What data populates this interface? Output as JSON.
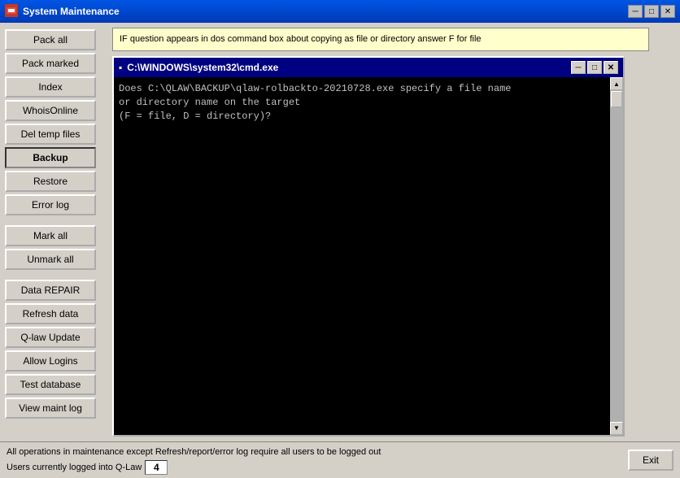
{
  "window": {
    "title": "System Maintenance",
    "title_icon": "⚙"
  },
  "titlebar_controls": {
    "minimize": "─",
    "maximize": "□",
    "close": "✕"
  },
  "sidebar": {
    "buttons": [
      {
        "id": "pack-all",
        "label": "Pack all",
        "active": false
      },
      {
        "id": "pack-marked",
        "label": "Pack marked",
        "active": false
      },
      {
        "id": "index",
        "label": "Index",
        "active": false
      },
      {
        "id": "whois-online",
        "label": "WhoisOnline",
        "active": false
      },
      {
        "id": "del-temp-files",
        "label": "Del temp files",
        "active": false
      },
      {
        "id": "backup",
        "label": "Backup",
        "active": true
      },
      {
        "id": "restore",
        "label": "Restore",
        "active": false
      },
      {
        "id": "error-log",
        "label": "Error log",
        "active": false
      },
      {
        "id": "mark-all",
        "label": "Mark all",
        "active": false
      },
      {
        "id": "unmark-all",
        "label": "Unmark all",
        "active": false
      },
      {
        "id": "data-repair",
        "label": "Data REPAIR",
        "active": false
      },
      {
        "id": "refresh-data",
        "label": "Refresh data",
        "active": false
      },
      {
        "id": "q-law-update",
        "label": "Q-law Update",
        "active": false
      },
      {
        "id": "allow-logins",
        "label": "Allow Logins",
        "active": false
      },
      {
        "id": "test-database",
        "label": "Test database",
        "active": false
      },
      {
        "id": "view-maint-log",
        "label": "View maint log",
        "active": false
      }
    ]
  },
  "info_box": {
    "text": "IF question appears in dos command box about copying as file or directory answer F for file"
  },
  "cmd_window": {
    "title": "C:\\WINDOWS\\system32\\cmd.exe",
    "title_icon": "▪",
    "controls": {
      "minimize": "─",
      "maximize": "□",
      "close": "✕"
    },
    "content": "Does C:\\QLAW\\BACKUP\\qlaw-rolbackto-20210728.exe specify a file name\nor directory name on the target\n(F = file, D = directory)?"
  },
  "status_bar": {
    "line1": "All operations in maintenance except Refresh/report/error log require all users to be logged out",
    "line2": "Users currently logged into Q-Law",
    "users_count": "4",
    "exit_label": "Exit"
  }
}
